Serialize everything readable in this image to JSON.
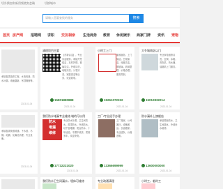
{
  "topbar": {
    "left_text": "切扑换加利新用频就务会确",
    "right_text": "切换城市"
  },
  "search": {
    "placeholder": "请输入您要查找的服务",
    "button_label": "搜索"
  },
  "nav": {
    "items": [
      "首页",
      "房产网",
      "招聘网",
      "求职",
      "交友相亲",
      "生活商务",
      "教育",
      "休闲娱乐",
      "商家门牌",
      "资讯",
      "宠物"
    ]
  },
  "cards": [
    {
      "title": "清理项目主要",
      "desc": "【东新请洁】，专业清洁服务，承接开荒保洁，石材护理，玻璃清洁，外墙清洗，地毯清洗，沙发清洗，家庭保洁等业务，欢迎致电。",
      "phone": "15801880888",
      "date": "2023-01-04"
    },
    {
      "title": "小时工上门",
      "desc": "家政服务，上门保洁，日常保洁，深度清洁，擦玻璃，收纳整理，价格合理，服务周到。",
      "phone": "15261072222",
      "date": "2023-01-04"
    },
    {
      "title": "大冬城南区以门",
      "desc": "专业家电维修清洗，空调，冰箱，洗衣机，热水器，油烟机上门服务。",
      "phone": "15012832214",
      "date": "2023-01-04"
    },
    {
      "title": "",
      "desc": "承接各类装修工程，水电改造，防水补漏，墙面翻新，吊顶隔断等。",
      "phone": "",
      "date": "2023-01-04"
    },
    {
      "title": "",
      "desc": "承接各类管道疏通，下水道，马桶，地漏，化粪池清理，专业设备。",
      "phone": "",
      "date": "2023-01-04"
    },
    {
      "title": "我们防水堵漏专业维修,堵的可以用",
      "desc": "专业防水补漏，卫生间防水，屋顶防水，外墙防水，地下室堵漏，阳台防水，十年经验，不漏不收费，质保多年，欢迎来电。",
      "phone": "17732221020",
      "date": "2023-01-04"
    },
    {
      "title": "工厂/专业经手办理",
      "desc": "工厂搬家，公司搬迁，设备搬运，长途搬家，专业团队，价格透明。",
      "phone": "13366699999",
      "date": "2023-01-04"
    },
    {
      "title": "防水漏补上旗舰店",
      "desc": "承接屋面防水，卫生间漏水，外墙渗水维修。",
      "phone": "13600000000",
      "date": "2023-01-04"
    },
    {
      "title": "我们防水卫生间漏水，墙体可维修",
      "desc": "",
      "phone": "",
      "date": ""
    },
    {
      "title": "专业疏通清理",
      "desc": "",
      "phone": "",
      "date": ""
    },
    {
      "title": "小时工，临时工",
      "desc": "",
      "phone": "",
      "date": ""
    }
  ],
  "colors": {
    "brand": "#1e88e5",
    "accent": "#e53935",
    "phone": "#2e7d32"
  }
}
